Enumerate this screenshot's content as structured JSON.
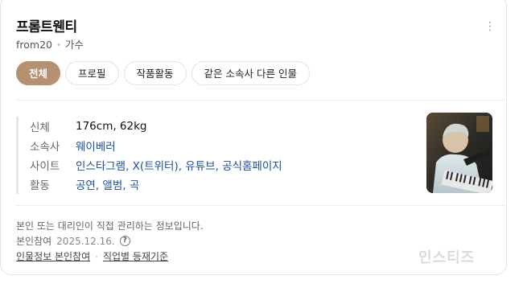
{
  "header": {
    "title": "프롬트웬티",
    "subtitle_name": "from20",
    "subtitle_role": "가수"
  },
  "tabs": [
    {
      "label": "전체",
      "active": true
    },
    {
      "label": "프로필",
      "active": false
    },
    {
      "label": "작품활동",
      "active": false
    },
    {
      "label": "같은 소속사 다른 인물",
      "active": false
    }
  ],
  "info": {
    "rows": [
      {
        "key": "신체",
        "value": "176cm, 62kg"
      },
      {
        "key": "소속사",
        "value": "웨이베러"
      },
      {
        "key": "사이트",
        "value": "인스타그램, X(트위터), 유튜브, 공식홈페이지"
      },
      {
        "key": "활동",
        "value": "공연, 앨범, 곡"
      }
    ]
  },
  "footer": {
    "notice": "본인 또는 대리인이 직접 관리하는 정보입니다.",
    "participation_label": "본인참여",
    "participation_date": "2025.12.16.",
    "help_icon": "?",
    "link_profile": "인물정보 본인참여",
    "link_criteria": "직업별 등재기준"
  },
  "watermark": "인스티즈",
  "colors": {
    "accent": "#b59171",
    "link": "#1a4fa3"
  },
  "icons": {
    "more": "more-vertical-icon",
    "help": "question-circle-icon"
  }
}
